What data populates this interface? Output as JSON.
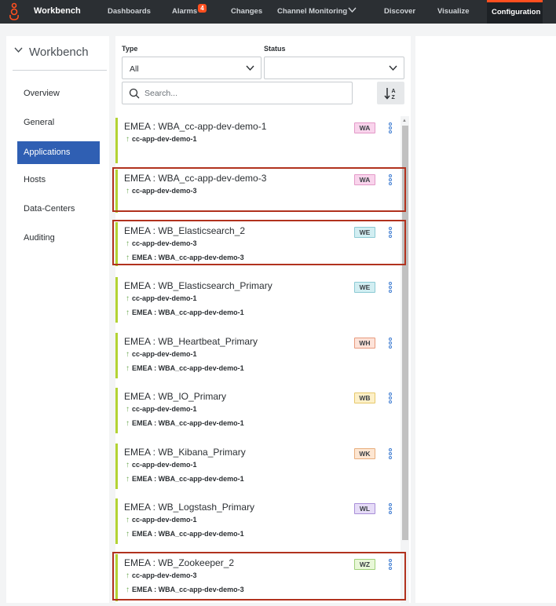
{
  "topbar": {
    "app_title": "Workbench",
    "nav": [
      {
        "label": "Dashboards"
      },
      {
        "label": "Alarms",
        "badge": "4"
      },
      {
        "label": "Changes"
      },
      {
        "label": "Channel Monitoring"
      },
      {
        "label": "Discover"
      },
      {
        "label": "Visualize"
      },
      {
        "label": "Configuration",
        "active": true
      }
    ],
    "accent_color": "#ff4f1f"
  },
  "sidebar": {
    "section_title": "Workbench",
    "items": [
      {
        "label": "Overview"
      },
      {
        "label": "General"
      },
      {
        "label": "Applications",
        "active": true
      },
      {
        "label": "Hosts"
      },
      {
        "label": "Data-Centers"
      },
      {
        "label": "Auditing"
      }
    ]
  },
  "filters": {
    "type_label": "Type",
    "type_value": "All",
    "status_label": "Status",
    "status_value": "",
    "search_placeholder": "Search..."
  },
  "cards": [
    {
      "title": "EMEA : WBA_cc-app-dev-demo-1",
      "tag": "WA",
      "tag_bg": "#f9d4ec",
      "tag_border": "#e39ac8",
      "subs": [
        "cc-app-dev-demo-1"
      ],
      "highlighted": false
    },
    {
      "title": "EMEA : WBA_cc-app-dev-demo-3",
      "tag": "WA",
      "tag_bg": "#f9d4ec",
      "tag_border": "#e39ac8",
      "subs": [
        "cc-app-dev-demo-3"
      ],
      "highlighted": true
    },
    {
      "title": "EMEA : WB_Elasticsearch_2",
      "tag": "WE",
      "tag_bg": "#d2eef2",
      "tag_border": "#8ccad4",
      "subs": [
        "cc-app-dev-demo-3",
        "EMEA : WBA_cc-app-dev-demo-3"
      ],
      "highlighted": true
    },
    {
      "title": "EMEA : WB_Elasticsearch_Primary",
      "tag": "WE",
      "tag_bg": "#d2eef2",
      "tag_border": "#8ccad4",
      "subs": [
        "cc-app-dev-demo-1",
        "EMEA : WBA_cc-app-dev-demo-1"
      ],
      "highlighted": false
    },
    {
      "title": "EMEA : WB_Heartbeat_Primary",
      "tag": "WH",
      "tag_bg": "#fde3d9",
      "tag_border": "#e89a7d",
      "subs": [
        "cc-app-dev-demo-1",
        "EMEA : WBA_cc-app-dev-demo-1"
      ],
      "highlighted": false
    },
    {
      "title": "EMEA : WB_IO_Primary",
      "tag": "WB",
      "tag_bg": "#fdf0c8",
      "tag_border": "#e6c86b",
      "subs": [
        "cc-app-dev-demo-1",
        "EMEA : WBA_cc-app-dev-demo-1"
      ],
      "highlighted": false
    },
    {
      "title": "EMEA : WB_Kibana_Primary",
      "tag": "WK",
      "tag_bg": "#fde6d2",
      "tag_border": "#e8ae7d",
      "subs": [
        "cc-app-dev-demo-1",
        "EMEA : WBA_cc-app-dev-demo-1"
      ],
      "highlighted": false
    },
    {
      "title": "EMEA : WB_Logstash_Primary",
      "tag": "WL",
      "tag_bg": "#e6dcf7",
      "tag_border": "#a98fd8",
      "subs": [
        "cc-app-dev-demo-1",
        "EMEA : WBA_cc-app-dev-demo-1"
      ],
      "highlighted": false
    },
    {
      "title": "EMEA : WB_Zookeeper_2",
      "tag": "WZ",
      "tag_bg": "#e8f7d8",
      "tag_border": "#9fd07a",
      "subs": [
        "cc-app-dev-demo-3",
        "EMEA : WBA_cc-app-dev-demo-3"
      ],
      "highlighted": true
    }
  ],
  "colors": {
    "card_border": "#b3d334",
    "highlight": "#b1321e",
    "active_sidebar": "#2f5fb3"
  },
  "icons": [
    "genesys-logo-icon",
    "chevron-down-icon",
    "search-icon",
    "sort-az-icon",
    "kebab-menu-icon",
    "arrow-up-icon"
  ]
}
